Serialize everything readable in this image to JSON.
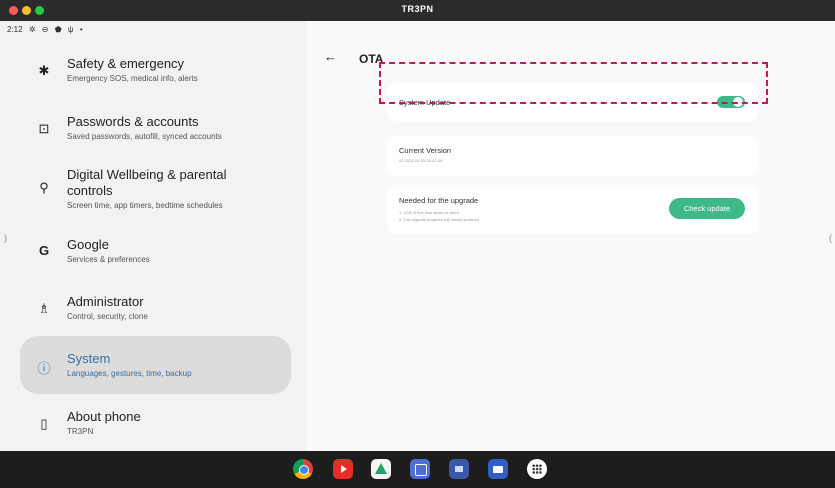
{
  "window": {
    "title": "TR3PN"
  },
  "status": {
    "time": "2:12",
    "icons": [
      "gear-icon",
      "ring-icon",
      "shield-icon",
      "usb-icon",
      "dot-icon"
    ]
  },
  "left_items": [
    {
      "icon": "asterisk-icon",
      "glyph": "✱",
      "title": "Safety & emergency",
      "sub": "Emergency SOS, medical info, alerts"
    },
    {
      "icon": "password-icon",
      "glyph": "⊡",
      "title": "Passwords & accounts",
      "sub": "Saved passwords, autofill, synced accounts"
    },
    {
      "icon": "wellbeing-icon",
      "glyph": "⚲",
      "title_line1": "Digital Wellbeing & parental",
      "title_line2": "controls",
      "sub": "Screen time, app timers, bedtime schedules"
    },
    {
      "icon": "google-icon",
      "glyph": "G",
      "title": "Google",
      "sub": "Services & preferences"
    },
    {
      "icon": "admin-icon",
      "glyph": "♗",
      "title": "Administrator",
      "sub": "Control, security, clone"
    },
    {
      "icon": "info-icon",
      "glyph": "ⓘ",
      "title": "System",
      "sub": "Languages, gestures, time, backup"
    },
    {
      "icon": "phone-icon",
      "glyph": "▯",
      "title": "About phone",
      "sub": "TR3PN"
    }
  ],
  "page": {
    "back_glyph": "←",
    "title": "OTA"
  },
  "system_update": {
    "label": "System Update",
    "enabled": true
  },
  "current_version": {
    "label": "Current Version",
    "value": "03 2024-09-20-09-43-46"
  },
  "upgrade": {
    "title": "Needed for the upgrade",
    "notes": [
      "1. 2GB of free disk space or more",
      "2. The upgrade progress will remain powered"
    ],
    "button": "Check update"
  },
  "edges": {
    "left": ")",
    "right": "("
  },
  "taskbar": [
    {
      "icon": "chrome-icon",
      "color": "#e5e5e5"
    },
    {
      "icon": "youtube-icon",
      "color": "#e52d27"
    },
    {
      "icon": "drive-icon",
      "color": "#f4f4f4"
    },
    {
      "icon": "notes-icon",
      "color": "#4f6fd1"
    },
    {
      "icon": "photos-icon",
      "color": "#3a57a8"
    },
    {
      "icon": "folder-icon",
      "color": "#2f5fc4"
    },
    {
      "icon": "app-drawer-icon",
      "color": "#ffffff"
    }
  ],
  "colors": {
    "accent": "#3fb98a",
    "highlight": "#c2185b",
    "selected_text": "#3a6ea5"
  }
}
